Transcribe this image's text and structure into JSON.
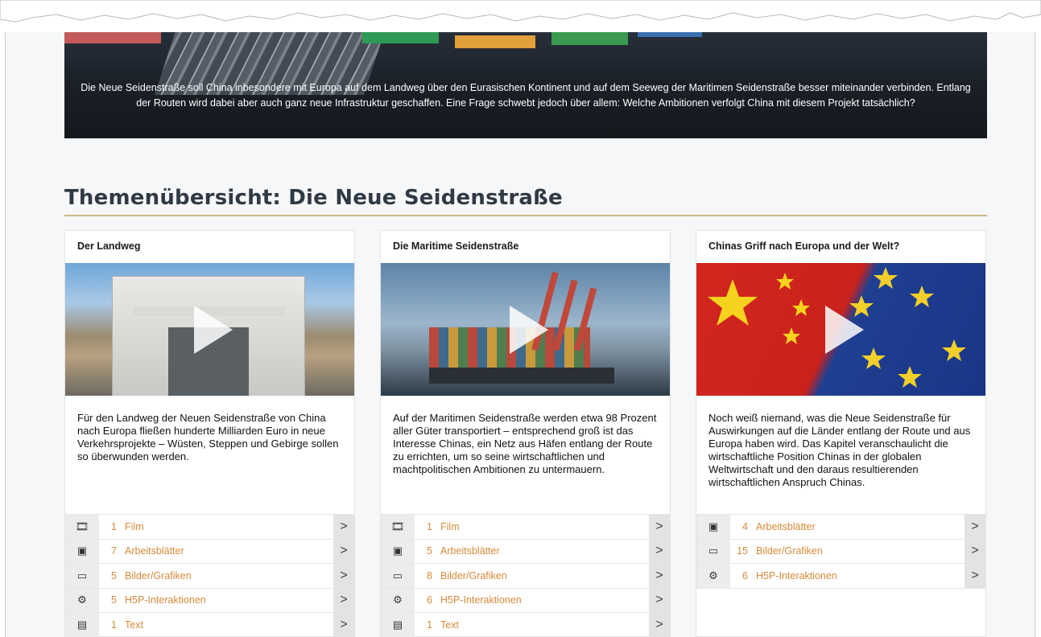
{
  "hero": {
    "caption": "Die Neue Seidenstraße soll China inbesondere mit Europa auf dem Landweg über den Eurasischen Kontinent und auf dem Seeweg der Maritimen Seidenstraße besser miteinander verbinden. Entlang der Routen wird dabei aber auch ganz neue Infrastruktur geschaffen. Eine Frage schwebt jedoch über allem: Welche Ambitionen verfolgt China mit diesem Projekt tatsächlich?"
  },
  "section": {
    "title": "Themenübersicht: Die Neue Seidenstraße"
  },
  "cards": [
    {
      "title": "Der Landweg",
      "image": "border-gate-photo",
      "text": "Für den Landweg der Neuen Seidenstraße von China nach Europa fließen hunderte Milliarden Euro in neue Verkehrsprojekte – Wüsten, Steppen und Gebirge sollen so überwunden werden.",
      "resources": [
        {
          "icon": "film-icon",
          "glyph": "🎞",
          "count": "1",
          "label": "Film"
        },
        {
          "icon": "pdf-icon",
          "glyph": "▣",
          "count": "7",
          "label": "Arbeitsblätter"
        },
        {
          "icon": "image-icon",
          "glyph": "▭",
          "count": "5",
          "label": "Bilder/Grafiken"
        },
        {
          "icon": "gears-icon",
          "glyph": "⚙",
          "count": "5",
          "label": "H5P-Interaktionen"
        },
        {
          "icon": "text-file-icon",
          "glyph": "▤",
          "count": "1",
          "label": "Text"
        }
      ]
    },
    {
      "title": "Die Maritime Seidenstraße",
      "image": "container-ship-photo",
      "text": "Auf der Maritimen Seidenstraße werden etwa 98 Prozent aller Güter transportiert – entsprechend groß ist das Interesse Chinas, ein Netz aus Häfen entlang der Route zu errichten, um so seine wirtschaftlichen und machtpolitischen Ambitionen zu untermauern.",
      "resources": [
        {
          "icon": "film-icon",
          "glyph": "🎞",
          "count": "1",
          "label": "Film"
        },
        {
          "icon": "pdf-icon",
          "glyph": "▣",
          "count": "5",
          "label": "Arbeitsblätter"
        },
        {
          "icon": "image-icon",
          "glyph": "▭",
          "count": "8",
          "label": "Bilder/Grafiken"
        },
        {
          "icon": "gears-icon",
          "glyph": "⚙",
          "count": "6",
          "label": "H5P-Interaktionen"
        },
        {
          "icon": "text-file-icon",
          "glyph": "▤",
          "count": "1",
          "label": "Text"
        }
      ]
    },
    {
      "title": "Chinas Griff nach Europa und der Welt?",
      "image": "china-eu-flags-photo",
      "text": "Noch weiß niemand, was die Neue Seidenstraße für Auswirkungen auf die Länder entlang der Route und aus Europa haben wird. Das Kapitel veranschaulicht die wirtschaftliche Position Chinas in der globalen Weltwirtschaft und den daraus resultierenden wirtschaftlichen Anspruch Chinas.",
      "resources": [
        {
          "icon": "pdf-icon",
          "glyph": "▣",
          "count": "4",
          "label": "Arbeitsblätter"
        },
        {
          "icon": "image-icon",
          "glyph": "▭",
          "count": "15",
          "label": "Bilder/Grafiken"
        },
        {
          "icon": "gears-icon",
          "glyph": "⚙",
          "count": "6",
          "label": "H5P-Interaktionen"
        }
      ]
    }
  ],
  "arrow_glyph": ">",
  "colors": {
    "accent": "#d88a3a",
    "rule": "#cbb98a",
    "hero_bg": "#1a1f26"
  }
}
